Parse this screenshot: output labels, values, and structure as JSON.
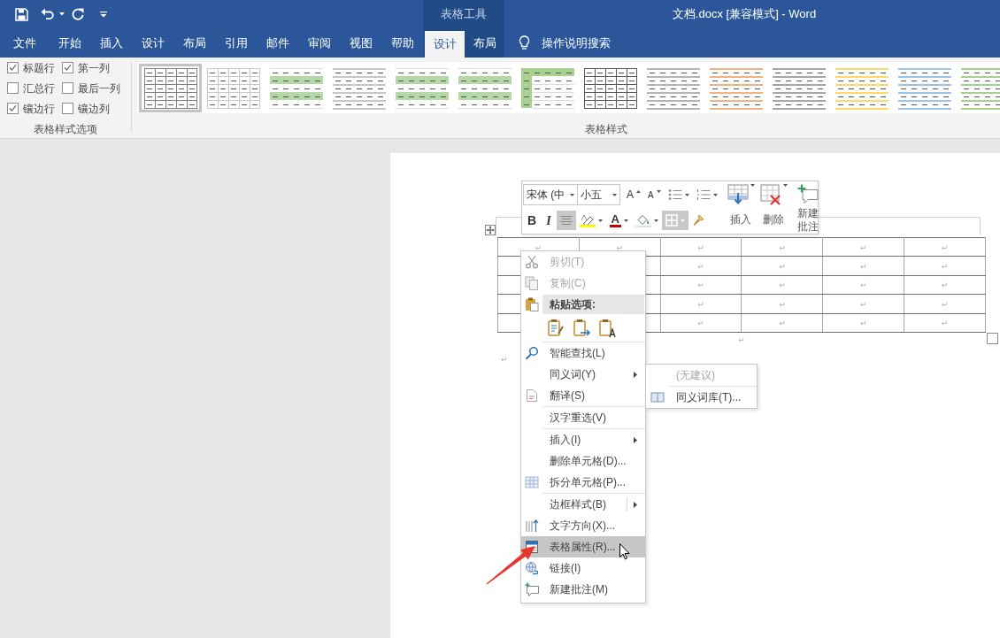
{
  "title_bar": {
    "contextual_group": "表格工具",
    "title": "文档.docx [兼容模式] - Word"
  },
  "tabs": [
    {
      "label": "文件",
      "selected": false
    },
    {
      "label": "开始",
      "selected": false
    },
    {
      "label": "插入",
      "selected": false
    },
    {
      "label": "设计",
      "selected": false
    },
    {
      "label": "布局",
      "selected": false
    },
    {
      "label": "引用",
      "selected": false
    },
    {
      "label": "邮件",
      "selected": false
    },
    {
      "label": "审阅",
      "selected": false
    },
    {
      "label": "视图",
      "selected": false
    },
    {
      "label": "帮助",
      "selected": false
    }
  ],
  "contextual_tabs": [
    {
      "label": "设计",
      "selected": true
    },
    {
      "label": "布局",
      "selected": false
    }
  ],
  "tell_me": {
    "label": "操作说明搜索"
  },
  "ribbon": {
    "style_options": {
      "options": [
        {
          "label": "标题行",
          "checked": true
        },
        {
          "label": "第一列",
          "checked": true
        },
        {
          "label": "汇总行",
          "checked": false
        },
        {
          "label": "最后一列",
          "checked": false
        },
        {
          "label": "镶边行",
          "checked": true
        },
        {
          "label": "镶边列",
          "checked": false
        }
      ],
      "title": "表格样式选项"
    },
    "table_styles": {
      "styles": [
        {
          "kind": "grid",
          "color": "#808080",
          "selected": true
        },
        {
          "kind": "grid",
          "color": "#c8c8c8",
          "selected": false
        },
        {
          "kind": "bands",
          "color": "#b5d9a6",
          "selected": false
        },
        {
          "kind": "lines",
          "color": "#c8c8c8",
          "selected": false
        },
        {
          "kind": "bands",
          "color": "#b5d9a6",
          "selected": false
        },
        {
          "kind": "bands",
          "color": "#b5d9a6",
          "selected": false
        },
        {
          "kind": "header-column",
          "color": "#a9d08e",
          "selected": false
        },
        {
          "kind": "grid",
          "color": "#595959",
          "selected": false
        },
        {
          "kind": "lines",
          "color": "#b4b4b4",
          "selected": false
        },
        {
          "kind": "lines",
          "color": "#f4b183",
          "selected": false
        },
        {
          "kind": "lines",
          "color": "#a6a6a6",
          "selected": false
        },
        {
          "kind": "lines",
          "color": "#ffd966",
          "selected": false
        },
        {
          "kind": "lines",
          "color": "#9dc3e6",
          "selected": false
        },
        {
          "kind": "lines",
          "color": "#a9d18e",
          "selected": false
        }
      ],
      "title": "表格样式"
    }
  },
  "document": {
    "mini_toolbar": {
      "font_name": "宋体 (中",
      "font_size": "小五",
      "row_1": [
        {
          "kind": "grow",
          "label": "A",
          "on": false
        },
        {
          "kind": "shrink",
          "label": "A",
          "on": false
        },
        {
          "kind": "bullets",
          "on": false
        },
        {
          "kind": "numbering",
          "on": false
        }
      ],
      "row_2": [
        {
          "kind": "bold",
          "label": "B",
          "on": false
        },
        {
          "kind": "italic",
          "label": "I",
          "on": false
        },
        {
          "kind": "align",
          "on": true
        },
        {
          "kind": "highlight",
          "on": false
        },
        {
          "kind": "font-color",
          "label": "A",
          "on": false
        },
        {
          "kind": "shading",
          "on": false
        },
        {
          "kind": "borders",
          "on": true
        },
        {
          "kind": "painter",
          "on": false
        }
      ],
      "commands": [
        {
          "kind": "insert",
          "label": "插入"
        },
        {
          "kind": "delete",
          "label": "删除"
        },
        {
          "kind": "comment",
          "label": "新建批注"
        }
      ]
    },
    "table": {
      "rows": [
        {
          "cells": [
            "↵",
            "↵",
            "↵",
            "↵",
            "↵",
            "↵"
          ]
        },
        {
          "cells": [
            null,
            null,
            "↵",
            "↵",
            "↵",
            "↵"
          ]
        },
        {
          "cells": [
            null,
            null,
            "↵",
            "↵",
            "↵",
            "↵"
          ]
        },
        {
          "cells": [
            null,
            null,
            "↵",
            "↵",
            "↵",
            "↵"
          ]
        },
        {
          "cells": [
            null,
            null,
            "↵",
            "↵",
            "↵",
            "↵"
          ]
        }
      ]
    },
    "paragraph_marks": [
      {
        "kind": "centered",
        "text": "↵"
      },
      {
        "kind": "plain",
        "text": "↵"
      }
    ]
  },
  "context_menu": {
    "items": [
      {
        "kind": "item",
        "label": "剪切(T)",
        "disabled": true,
        "selected": false,
        "submenu": false
      },
      {
        "kind": "item",
        "label": "复制(C)",
        "disabled": true,
        "selected": false,
        "submenu": false
      },
      {
        "kind": "header",
        "label": "粘贴选项:"
      },
      {
        "kind": "paste-options"
      },
      {
        "kind": "separator"
      },
      {
        "kind": "item",
        "label": "智能查找(L)",
        "disabled": false,
        "selected": false,
        "submenu": false
      },
      {
        "kind": "item",
        "label": "同义词(Y)",
        "disabled": false,
        "selected": false,
        "submenu": true,
        "children": [
          {
            "kind": "item",
            "label": "(无建议)",
            "disabled": true,
            "selected": false,
            "submenu": false
          },
          {
            "kind": "separator"
          },
          {
            "kind": "item",
            "label": "同义词库(T)...",
            "disabled": false,
            "selected": false,
            "submenu": false
          }
        ]
      },
      {
        "kind": "item",
        "label": "翻译(S)",
        "disabled": false,
        "selected": false,
        "submenu": false
      },
      {
        "kind": "separator"
      },
      {
        "kind": "item",
        "label": "汉字重选(V)",
        "disabled": false,
        "selected": false,
        "submenu": false
      },
      {
        "kind": "separator"
      },
      {
        "kind": "item",
        "label": "插入(I)",
        "disabled": false,
        "selected": false,
        "submenu": true
      },
      {
        "kind": "item",
        "label": "删除单元格(D)...",
        "disabled": false,
        "selected": false,
        "submenu": false
      },
      {
        "kind": "item",
        "label": "拆分单元格(P)...",
        "disabled": false,
        "selected": false,
        "submenu": false
      },
      {
        "kind": "separator"
      },
      {
        "kind": "split",
        "label": "边框样式(B)",
        "disabled": false,
        "selected": false,
        "submenu": true
      },
      {
        "kind": "item",
        "label": "文字方向(X)...",
        "disabled": false,
        "selected": false,
        "submenu": false
      },
      {
        "kind": "item",
        "label": "表格属性(R)...",
        "disabled": false,
        "selected": true,
        "submenu": false
      },
      {
        "kind": "item",
        "label": "链接(I)",
        "disabled": false,
        "selected": false,
        "submenu": false
      },
      {
        "kind": "item",
        "label": "新建批注(M)",
        "disabled": false,
        "selected": false,
        "submenu": false
      }
    ]
  }
}
